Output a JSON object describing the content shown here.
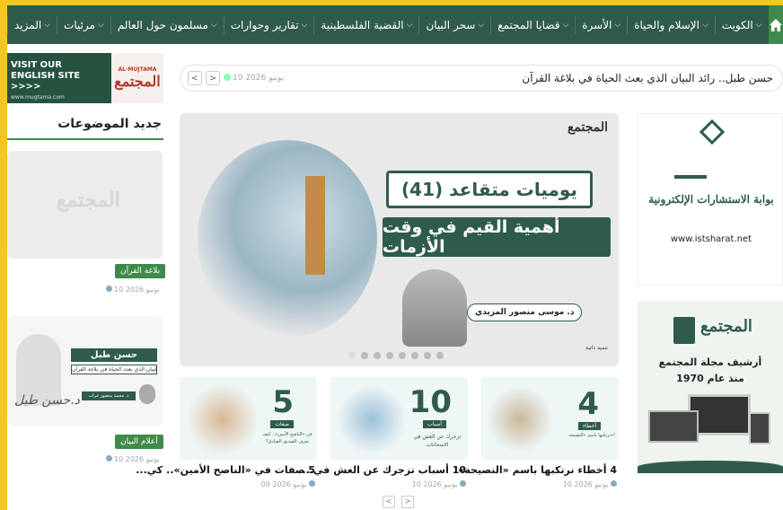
{
  "nav": {
    "home_label": "",
    "items": [
      {
        "label": "الكويت"
      },
      {
        "label": "الإسلام والحياة"
      },
      {
        "label": "الأسرة"
      },
      {
        "label": "قضايا المجتمع"
      },
      {
        "label": "سحر البيان"
      },
      {
        "label": "القضية الفلسطينية"
      },
      {
        "label": "تقارير وحوارات"
      },
      {
        "label": "مسلمون حول العالم"
      },
      {
        "label": "مرئيات"
      },
      {
        "label": "المزيد"
      }
    ]
  },
  "ticker": {
    "headline": "حسن طبل.. رائد البيان الذي بعث الحياة في بلاغة القرآن",
    "date": "10 يونيو 2026",
    "prev": "<",
    "next": ">"
  },
  "english_banner": {
    "line1": "VISIT OUR",
    "line2": "ENGLISH SITE",
    "line3": ">>>>",
    "site": "www.mugtama.com",
    "brand_en": "AL-MUJTAMA",
    "brand_ar": "المجتمع"
  },
  "latest": {
    "heading": "جديد الموضوعات",
    "items": [
      {
        "tag": "بلاغة القرآن",
        "date": "10 يونيو 2026",
        "placeholder_logo": "المجتمع"
      },
      {
        "tag": "أعلام البيان",
        "date": "10 يونيو 2026",
        "image_title": "حسن طبل",
        "image_sub": "رائد البيان الذي بعث الحياة في بلاغة القرآن",
        "image_author": "د. محمد منصور غراب",
        "signature": "د.حسن طبل"
      }
    ]
  },
  "slider": {
    "brand": "المجتمع",
    "title_line1": "يوميات متقاعد (41)",
    "title_line2": "أهمية القيم في وقت الأزمات",
    "author": "د. موسى منصور المزيدي",
    "section": "تنمية ذاتية",
    "dots": 8,
    "active_dot": 0
  },
  "ads": {
    "istisharat": {
      "title": "بوابة الاستشارات الإلكترونية",
      "url": "www.istsharat.net"
    },
    "archive": {
      "brand": "المجتمع",
      "line1": "أرشيف مجلة المجتمع",
      "line2": "منذ عام 1970"
    }
  },
  "cards": [
    {
      "title": "4 أخطاء نرتكبها باسم «النصيحة»!",
      "date": "10 يونيو 2026",
      "num": "4",
      "badge": "أخطاء",
      "sub": "نرتكبها باسم «النصيحة»!"
    },
    {
      "title": "10 أسباب تزجرك عن الغش في...",
      "date": "10 يونيو 2026",
      "num": "10",
      "badge": "أسباب",
      "sub": "تزجرك عن الغش في الامتحانات"
    },
    {
      "title": "5 صفات في «الناصح الأمين».. كي...",
      "date": "09 يونيو 2026",
      "num": "5",
      "badge": "صفات",
      "sub": "في «الناصح الأمين».. كيف تعرف الصديق الصادق؟"
    }
  ],
  "pagination": {
    "prev": "<",
    "next": ">"
  },
  "colors": {
    "nav": "#2f5b4c",
    "accent": "#3f8a4a",
    "frame": "#f2c81e"
  }
}
